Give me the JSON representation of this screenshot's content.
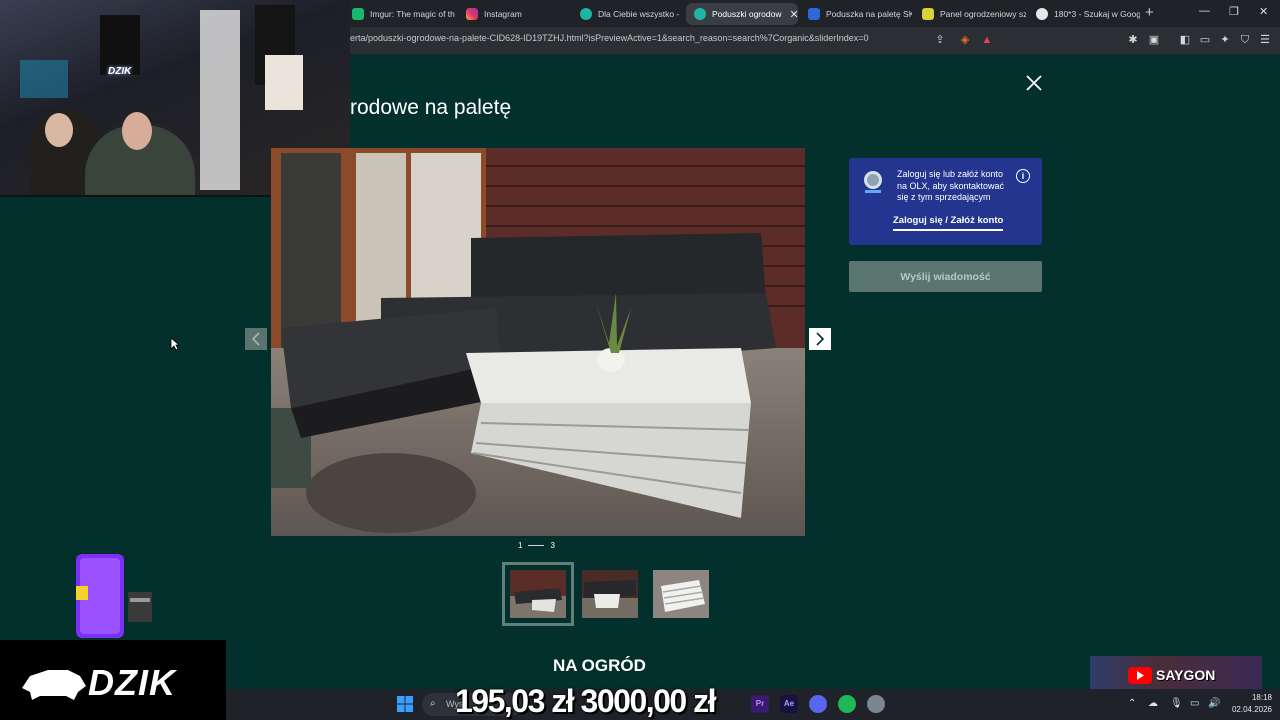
{
  "browser": {
    "tabs": [
      {
        "label": "Imgur: The magic of th",
        "color": "#1bb76e"
      },
      {
        "label": "Instagram",
        "color": "#e1306c"
      },
      {
        "label": "Dla Ciebie wszystko - ",
        "color": "#1fb5a6"
      },
      {
        "label": "Poduszki ogrodow",
        "color": "#1fb5a6",
        "active": true
      },
      {
        "label": "Poduszka na paletę SK",
        "color": "#2c68d8"
      },
      {
        "label": "Panel ogrodzeniowy sz",
        "color": "#d7d43b"
      },
      {
        "label": "180*3 - Szukaj w Goog",
        "color": "#e8e8e8"
      }
    ],
    "url": "erta/poduszki-ogrodowe-na-palete-CID628-ID19TZHJ.html?isPreviewActive=1&search_reason=search%7Corganic&sliderIndex=0"
  },
  "modal": {
    "title": "rodowe na paletę",
    "pager": {
      "current": "1",
      "total": "3"
    },
    "login_card": {
      "text": "Zaloguj się lub załóż konto na OLX, aby skontaktować się z tym sprzedającym",
      "link": "Zaloguj się / Załóż konto",
      "info": "i"
    },
    "send_button": "Wyślij wiadomość",
    "section_title": "NA OGRÓD"
  },
  "stream": {
    "price_overlay": "195,03 zł 3000,00 zł",
    "webcam_logo": "DZIK",
    "brand": "DZIK",
    "channel": "SAYGON"
  },
  "taskbar": {
    "search_placeholder": "Wys",
    "time": "18:18",
    "date": "02.04.2026"
  },
  "colors": {
    "background": "#03302d",
    "login_card": "#23358f",
    "send_button": "#5a7570"
  }
}
